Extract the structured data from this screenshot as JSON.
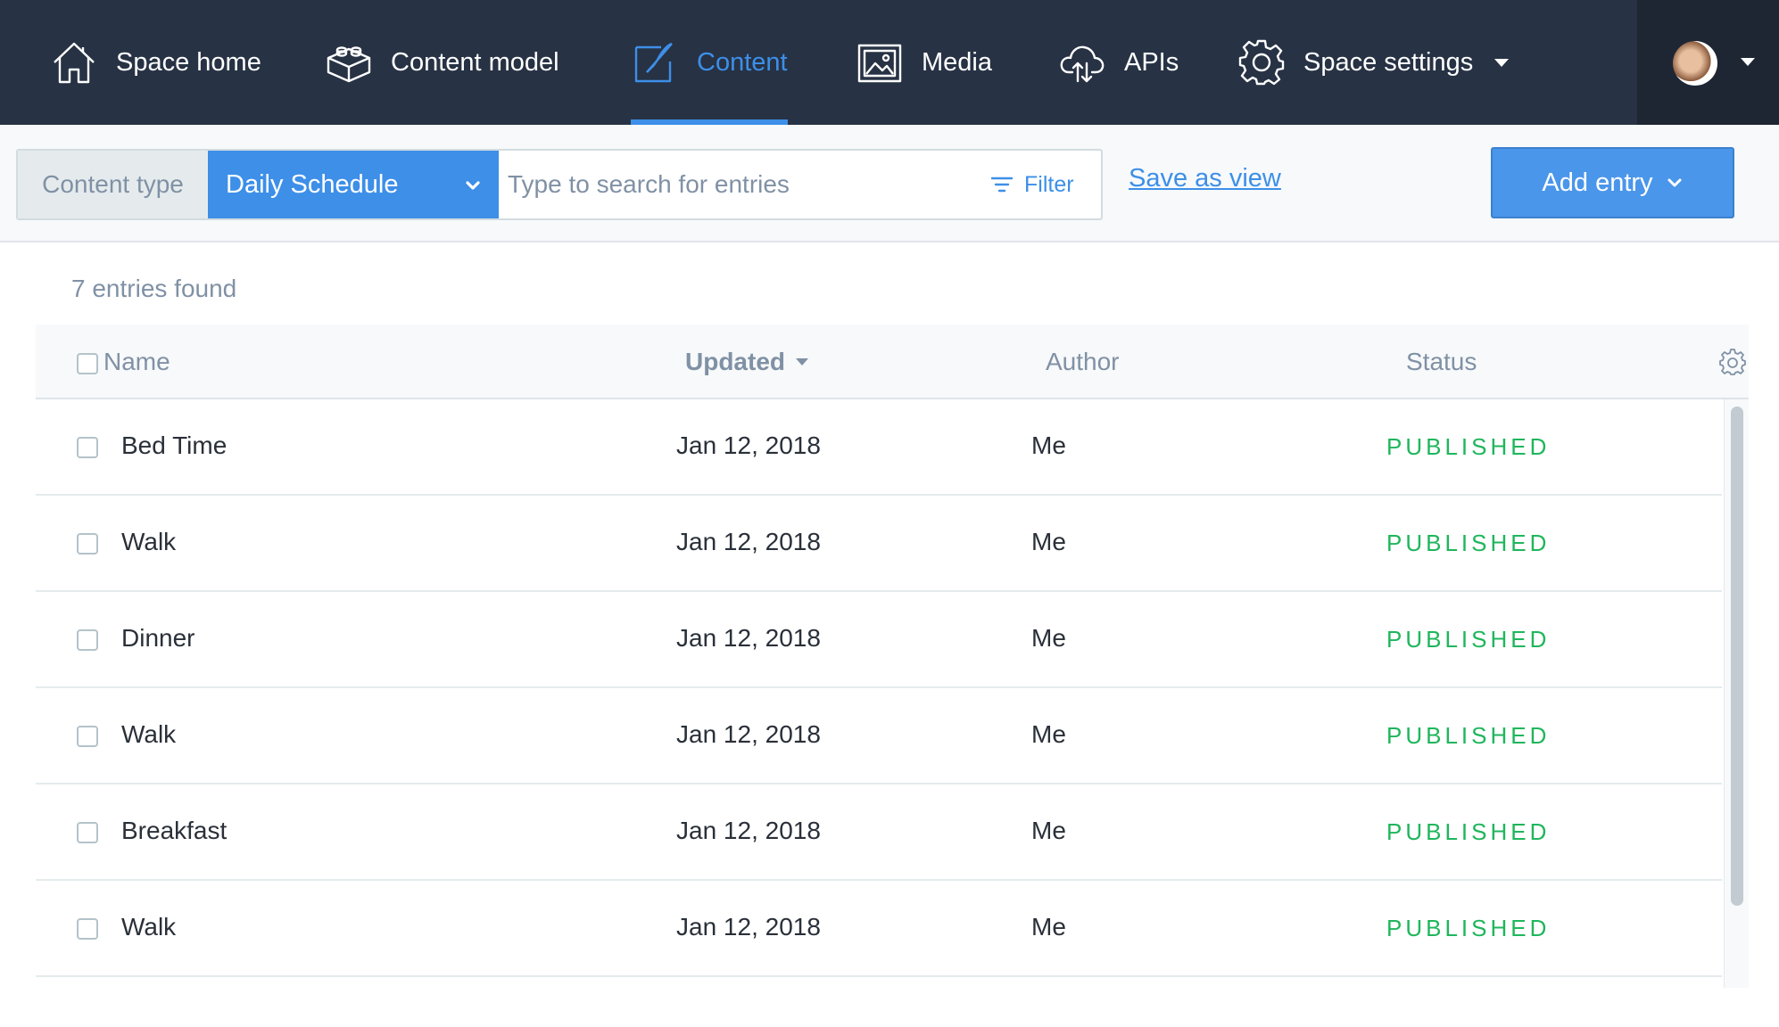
{
  "nav": {
    "items": [
      {
        "label": "Space home",
        "icon": "home-icon"
      },
      {
        "label": "Content model",
        "icon": "blocks-icon"
      },
      {
        "label": "Content",
        "icon": "pen-icon",
        "active": true
      },
      {
        "label": "Media",
        "icon": "image-icon"
      },
      {
        "label": "APIs",
        "icon": "cloud-icon"
      },
      {
        "label": "Space settings",
        "icon": "gear-icon"
      }
    ]
  },
  "toolbar": {
    "content_type_label": "Content type",
    "content_type_value": "Daily Schedule",
    "search_placeholder": "Type to search for entries",
    "filter_label": "Filter",
    "save_view_label": "Save as view",
    "add_entry_label": "Add entry"
  },
  "content": {
    "entries_found": "7 entries found",
    "columns": {
      "name": "Name",
      "updated": "Updated",
      "author": "Author",
      "status": "Status"
    },
    "rows": [
      {
        "name": "Bed Time",
        "updated": "Jan 12, 2018",
        "author": "Me",
        "status": "PUBLISHED"
      },
      {
        "name": "Walk",
        "updated": "Jan 12, 2018",
        "author": "Me",
        "status": "PUBLISHED"
      },
      {
        "name": "Dinner",
        "updated": "Jan 12, 2018",
        "author": "Me",
        "status": "PUBLISHED"
      },
      {
        "name": "Walk",
        "updated": "Jan 12, 2018",
        "author": "Me",
        "status": "PUBLISHED"
      },
      {
        "name": "Breakfast",
        "updated": "Jan 12, 2018",
        "author": "Me",
        "status": "PUBLISHED"
      },
      {
        "name": "Walk",
        "updated": "Jan 12, 2018",
        "author": "Me",
        "status": "PUBLISHED"
      }
    ]
  },
  "colors": {
    "nav_bg": "#273244",
    "accent": "#3d8fe8",
    "published": "#1fb65c"
  }
}
